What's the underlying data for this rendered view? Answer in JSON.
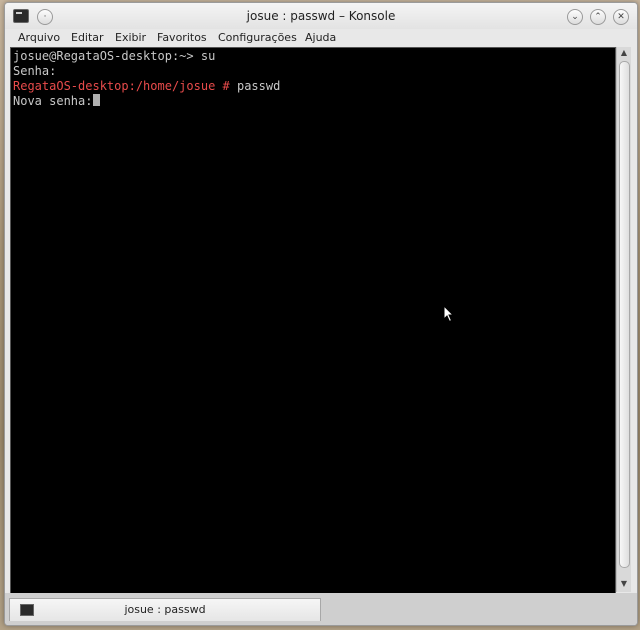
{
  "window": {
    "title": "josue : passwd – Konsole"
  },
  "menu": {
    "items": [
      "Arquivo",
      "Editar",
      "Exibir",
      "Favoritos",
      "Configurações",
      "Ajuda"
    ]
  },
  "terminal": {
    "lines": [
      "josue@RegataOS-desktop:~> su",
      "Senha:",
      "RegataOS-desktop:/home/josue #",
      "passwd",
      "Nova senha:"
    ]
  },
  "tab": {
    "label": "josue : passwd"
  },
  "icons": {
    "app": "terminal-icon",
    "pin": "pin-icon",
    "minimize": "chevron-down-icon",
    "maximize": "chevron-up-icon",
    "close": "close-icon"
  },
  "colors": {
    "terminal_bg": "#000000",
    "terminal_text": "#c8c8c8",
    "root_prompt": "#e84b4b"
  }
}
